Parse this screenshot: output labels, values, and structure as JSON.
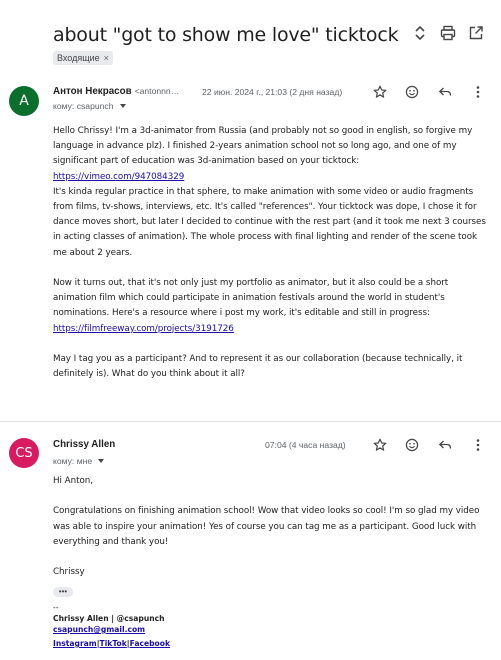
{
  "header": {
    "subject": "about \"got to show me love\" ticktock",
    "label": "Входящие",
    "label_close": "×"
  },
  "icons": {
    "expand": "unfold-icon",
    "print": "print-icon",
    "popout": "open-in-new-icon",
    "star": "star-icon",
    "emoji": "emoji-icon",
    "reply": "reply-icon",
    "more": "more-vert-icon"
  },
  "colors": {
    "avatar1": "#0b6e2d",
    "avatar2": "#d81b60",
    "link": "#1a0dab"
  },
  "message1": {
    "avatar_letter": "A",
    "sender_name": "Антон Некрасов",
    "sender_email": "<antonnn…",
    "date": "22 июн. 2024 г., 21:03 (2 дня назад)",
    "to": "кому: csapunch",
    "body": {
      "p1_before_link": "Hello Chrissy! I'm a 3d-animator from Russia (and probably not so good in english, so forgive my language in advance plz). I finished 2-years animation school not so long ago, and one of my significant part of education was 3d-animation based on your ticktock:",
      "p1_link": "https://vimeo.com/947084329",
      "p1_after_link": "It's kinda regular practice in that sphere, to make animation with some video or audio fragments from films, tv-shows, interviews, etc. It's called \"references\". Your ticktock was dope, I chose it for dance moves short, but later I decided to continue with the rest part (and it took me next 3 courses in acting classes of animation). The whole process with final lighting and render of the scene took me about 2 years.",
      "p2_before_link": "Now it turns out, that it's not only just my portfolio as animator, but it  also could be a short animation film which could participate in animation festivals around the world in student's nominations. Here's a resource where i post my work, it's editable and still in progress:",
      "p2_link": "https://filmfreeway.com/projects/3191726",
      "p3": "May I tag you as a participant? And to represent it as our collaboration (because technically, it definitely is). What do you think about it all?"
    }
  },
  "message2": {
    "avatar_letters": "CS",
    "sender_name": "Chrissy Allen",
    "date": "07:04 (4 часа назад)",
    "to": "кому: мне",
    "body": {
      "greeting": "Hi Anton,",
      "p1": "Congratulations on finishing animation school! Wow that video looks so cool! I'm so glad my video was able to inspire your animation! Yes of course you can tag me as a participant. Good luck with everything and thank you!",
      "signoff": "Chrissy",
      "ellipsis": "•••"
    },
    "signature": {
      "dash": "--",
      "name_line": "Chrissy Allen | @csapunch",
      "email": "csapunch@gmail.com",
      "link_instagram": "Instagram",
      "sep": " | ",
      "link_tiktok": "TikTok",
      "link_facebook": "Facebook"
    }
  }
}
